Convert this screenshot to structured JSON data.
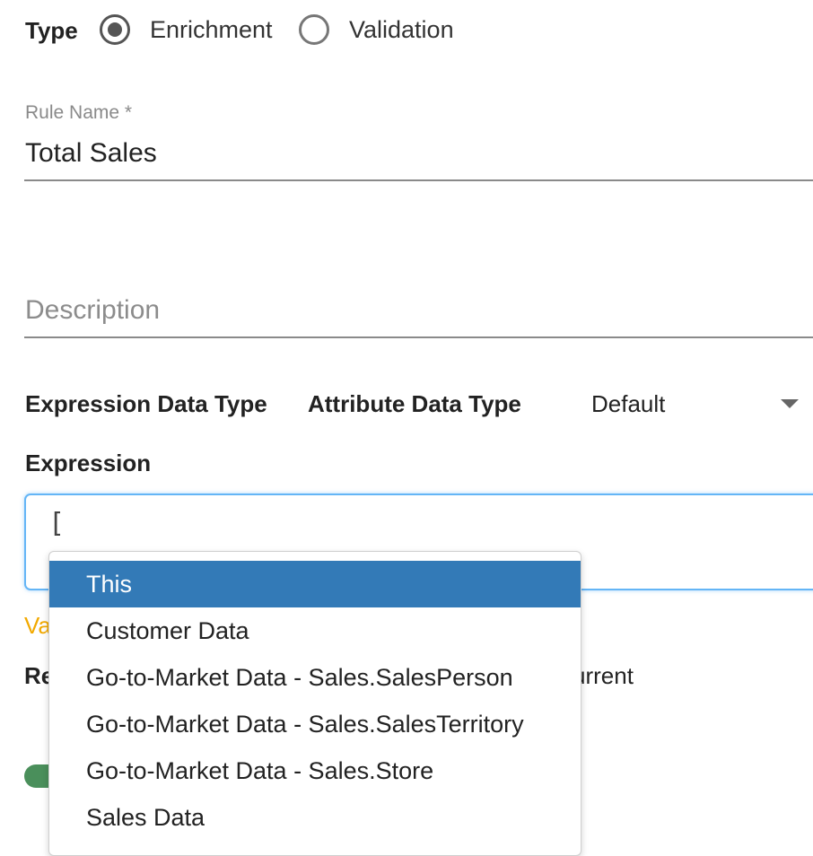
{
  "type_field": {
    "label": "Type",
    "options": [
      {
        "label": "Enrichment",
        "checked": true
      },
      {
        "label": "Validation",
        "checked": false
      }
    ]
  },
  "rule_name": {
    "label": "Rule Name *",
    "value": "Total Sales"
  },
  "description": {
    "placeholder": "Description"
  },
  "expression_data_type": {
    "label": "Expression Data Type"
  },
  "attribute_data_type": {
    "label": "Attribute Data Type",
    "selected": "Default"
  },
  "expression": {
    "label": "Expression",
    "value": "[",
    "hint_visible": "Va",
    "partially_hidden_left": "Re",
    "partially_hidden_right": "urrent"
  },
  "autocomplete": {
    "items": [
      "This",
      "Customer Data",
      "Go-to-Market Data - Sales.SalesPerson",
      "Go-to-Market Data - Sales.SalesTerritory",
      "Go-to-Market Data - Sales.Store",
      "Sales Data"
    ],
    "selected_index": 0
  },
  "colors": {
    "focus_border": "#64b5f6",
    "menu_highlight": "#337ab7",
    "hint": "#f2a900",
    "toggle": "#4a8f5b"
  }
}
